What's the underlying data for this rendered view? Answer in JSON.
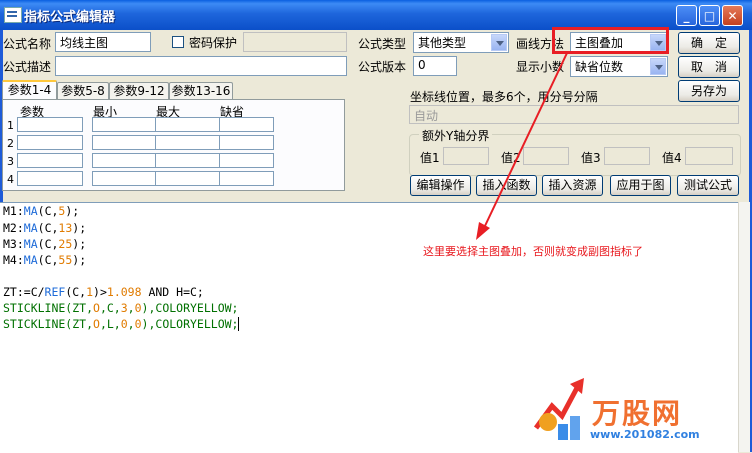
{
  "window": {
    "title": "指标公式编辑器",
    "minimize_glyph": "_",
    "maximize_glyph": "□",
    "close_glyph": "✕"
  },
  "form": {
    "name_label": "公式名称",
    "name_value": "均线主图",
    "password_label": "密码保护",
    "desc_label": "公式描述",
    "desc_value": "",
    "type_label": "公式类型",
    "type_value": "其他类型",
    "version_label": "公式版本",
    "version_value": "0",
    "draw_label": "画线方法",
    "draw_value": "主图叠加",
    "digits_label": "显示小数",
    "digits_value": "缺省位数"
  },
  "buttons": {
    "ok": "确　定",
    "cancel": "取　消",
    "save_as": "另存为",
    "edit_ops": "编辑操作",
    "insert_func": "插入函数",
    "insert_res": "插入资源",
    "apply_chart": "应用于图",
    "test_formula": "测试公式"
  },
  "tabs": [
    "参数1-4",
    "参数5-8",
    "参数9-12",
    "参数13-16"
  ],
  "params": {
    "headers": [
      "参数",
      "最小",
      "最大",
      "缺省"
    ],
    "rows": [
      "1",
      "2",
      "3",
      "4"
    ]
  },
  "coords": {
    "label": "坐标线位置，最多6个，用分号分隔",
    "placeholder": "自动"
  },
  "extra_y": {
    "label": "额外Y轴分界",
    "values": [
      "值1",
      "值2",
      "值3",
      "值4"
    ]
  },
  "code": {
    "l1": [
      "M1:",
      "MA",
      "(C,",
      "5",
      ");"
    ],
    "l2": [
      "M2:",
      "MA",
      "(C,",
      "13",
      ");"
    ],
    "l3": [
      "M3:",
      "MA",
      "(C,",
      "25",
      ");"
    ],
    "l4": [
      "M4:",
      "MA",
      "(C,",
      "55",
      ");"
    ],
    "l6": [
      "ZT:=C/",
      "REF",
      "(C,",
      "1",
      ")>",
      "1.098",
      " AND H=C;"
    ],
    "l7": [
      "STICKLINE(ZT,",
      "O",
      ",C,",
      "3",
      ",",
      "0",
      "),COLORYELLOW;"
    ],
    "l8": [
      "STICKLINE(ZT,",
      "O",
      ",L,",
      "0",
      ",",
      "0",
      "),COLORYELLOW;"
    ]
  },
  "annotation": {
    "note": "这里要选择主图叠加，否则就变成副图指标了",
    "color": "#E81E24"
  },
  "watermark": {
    "brand": "万股网",
    "url": "www.201082.com"
  }
}
